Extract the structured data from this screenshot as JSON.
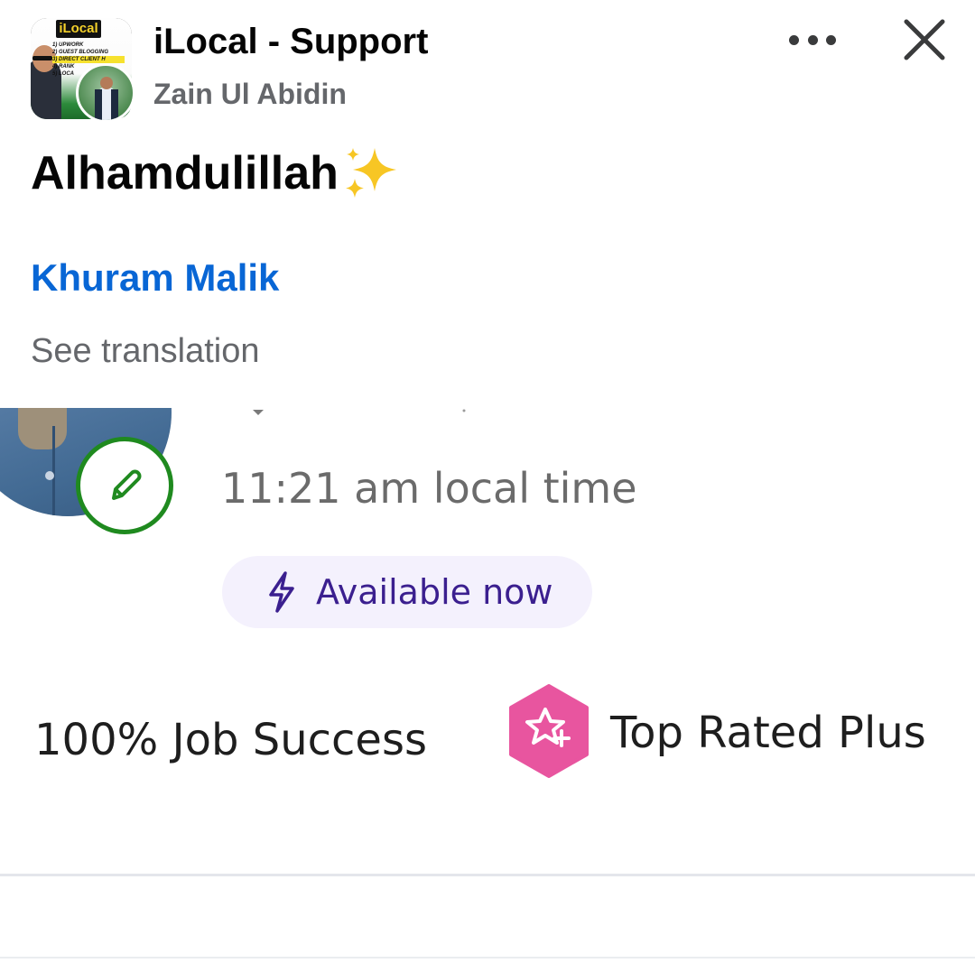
{
  "header": {
    "group_name": "iLocal - Support",
    "author_name": "Zain Ul Abidin",
    "group_avatar": {
      "logo_text": "iLocal",
      "list": [
        "1) UPWORK",
        "2) GUEST BLOGGING",
        "3) DIRECT CLIENT H",
        "4) RANK",
        "5) LOCA"
      ]
    },
    "more_icon": "more-horizontal-icon",
    "close_icon": "close-icon"
  },
  "post": {
    "text": "Alhamdulillah",
    "emoji": "sparkles-emoji",
    "mention": "Khuram Malik",
    "see_translation": "See translation"
  },
  "profile_screenshot": {
    "edit_icon": "pencil-icon",
    "local_time": "11:21 am local time",
    "availability": "Available now",
    "availability_icon": "lightning-bolt-icon",
    "job_success": "100% Job Success",
    "badge_icon": "star-plus-hexagon-icon",
    "badge_label": "Top Rated Plus"
  },
  "colors": {
    "link_blue": "#0866d5",
    "secondary_text": "#65676b",
    "edit_green": "#1f8a1f",
    "available_purple": "#3b1f8f",
    "available_bg": "#f4f1fd",
    "badge_pink": "#e8559f"
  }
}
